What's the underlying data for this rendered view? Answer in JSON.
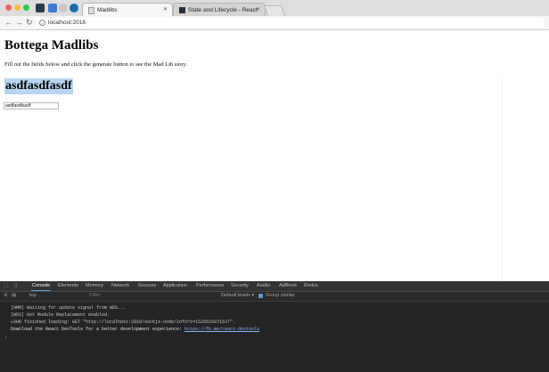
{
  "browser": {
    "tabs": [
      {
        "label": "Madlibs",
        "active": true
      },
      {
        "label": "State and Lifecycle - React",
        "active": false
      }
    ],
    "url": "localhost:2018"
  },
  "page": {
    "title": "Bottega Madlibs",
    "description": "Fill out the fields below and click the generate button to see the Mad Lib story.",
    "story_heading": "asdfasdfasdf",
    "input_value": "asdfasdfasdf"
  },
  "devtools": {
    "tabs": [
      "Console",
      "Elements",
      "Memory",
      "Network",
      "Sources",
      "Application",
      "Performance",
      "Security",
      "Audits",
      "AdBlock",
      "Redux"
    ],
    "context": "top",
    "filter_placeholder": "Filter",
    "levels": "Default levels ▾",
    "group_similar": "Group similar",
    "console_lines": [
      "[HMR] Waiting for update signal from WDS...",
      "[WDS] Hot Module Replacement enabled.",
      "▸XHR finished loading: GET \"http://localhost:2018/sockjs-node/info?t=1526515871537\".",
      "Download the React DevTools for a better development experience: "
    ],
    "react_devtools_link": "https://fb.me/react-devtools"
  },
  "colors": {
    "devtools_bg": "#242424",
    "selection_highlight": "#b8d4f2",
    "accent": "#5b9bd5"
  }
}
